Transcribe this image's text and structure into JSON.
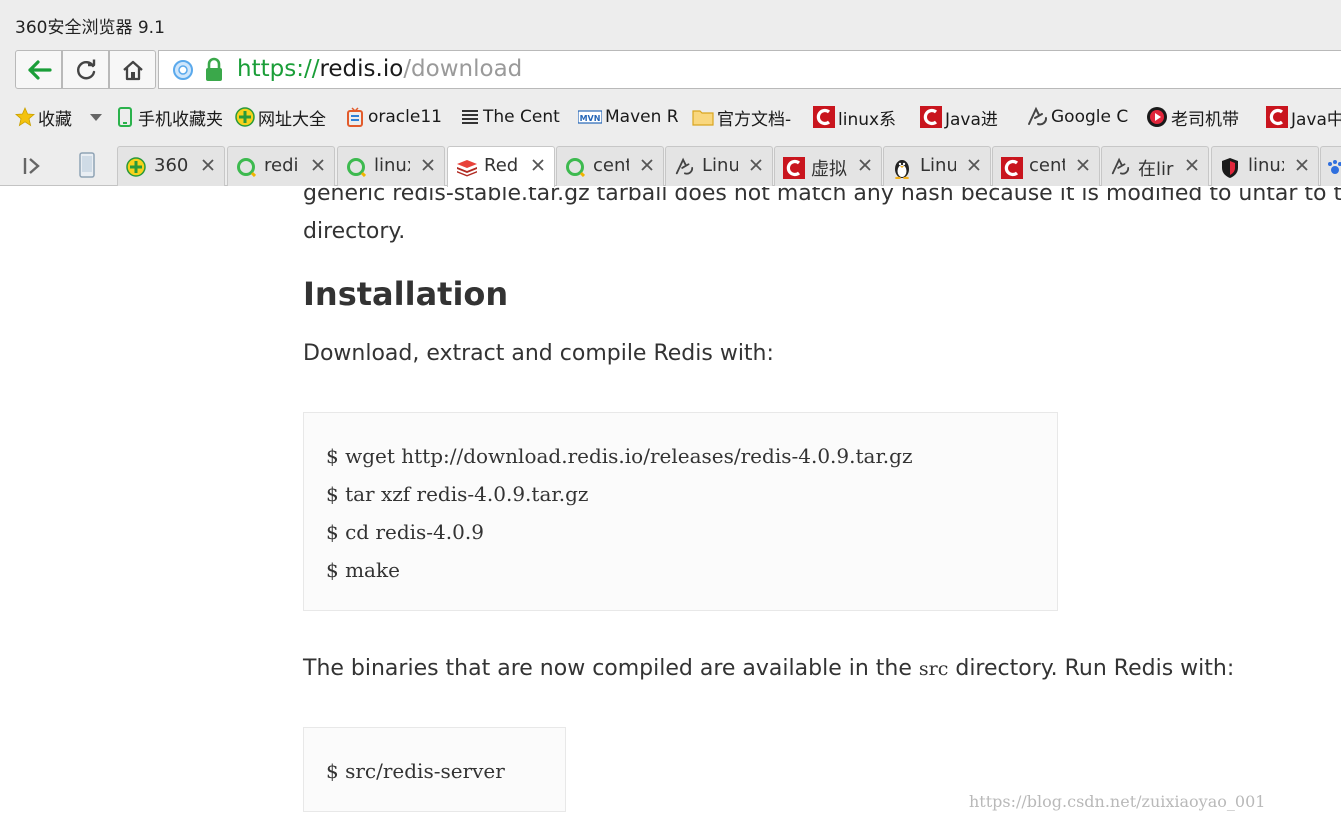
{
  "window": {
    "title": "360安全浏览器 9.1"
  },
  "nav": {
    "url_scheme": "https://",
    "url_host": "redis.io",
    "url_path": "/download"
  },
  "bookmarks": [
    {
      "label": "收藏",
      "icon": "star-icon"
    },
    {
      "label": "手机收藏夹",
      "icon": "phone-icon"
    },
    {
      "label": "网址大全",
      "icon": "360-icon"
    },
    {
      "label": "oracle11",
      "icon": "oracle-icon"
    },
    {
      "label": "The Cent",
      "icon": "doc-icon"
    },
    {
      "label": "Maven R",
      "icon": "mvn-icon"
    },
    {
      "label": "官方文档-",
      "icon": "folder-icon"
    },
    {
      "label": "linux系",
      "icon": "csdn-icon"
    },
    {
      "label": "Java进",
      "icon": "csdn-icon"
    },
    {
      "label": "Google C",
      "icon": "cnblogs-icon"
    },
    {
      "label": "老司机带",
      "icon": "video-icon"
    },
    {
      "label": "Java中",
      "icon": "csdn-icon"
    }
  ],
  "tabs": [
    {
      "label": "360",
      "icon": "360-icon",
      "active": false
    },
    {
      "label": "redi",
      "icon": "loading-icon",
      "active": false
    },
    {
      "label": "linux",
      "icon": "loading-icon",
      "active": false
    },
    {
      "label": "Red",
      "icon": "redis-icon",
      "active": true
    },
    {
      "label": "cent",
      "icon": "loading-icon",
      "active": false
    },
    {
      "label": "Linu",
      "icon": "cnblogs-icon",
      "active": false
    },
    {
      "label": "虚拟",
      "icon": "csdn-icon",
      "active": false
    },
    {
      "label": "Linu",
      "icon": "tux-icon",
      "active": false
    },
    {
      "label": "cent",
      "icon": "csdn-icon",
      "active": false
    },
    {
      "label": "在lir",
      "icon": "cnblogs-icon",
      "active": false
    },
    {
      "label": "linux",
      "icon": "shield-icon",
      "active": false
    }
  ],
  "page": {
    "cut_line": "generic redis-stable.tar.gz tarball does not match any hash because it is modified to untar to t",
    "directory_word": "directory.",
    "heading": "Installation",
    "download_text": "Download, extract and compile Redis with:",
    "code_lines": [
      "$ wget http://download.redis.io/releases/redis-4.0.9.tar.gz",
      "$ tar xzf redis-4.0.9.tar.gz",
      "$ cd redis-4.0.9",
      "$ make"
    ],
    "binaries_text_before": "The binaries that are now compiled are available in the ",
    "binaries_code": "src",
    "binaries_text_after": " directory. Run Redis with:",
    "run_code": "$ src/redis-server"
  },
  "watermark": "https://blog.csdn.net/zuixiaoyao_001",
  "colors": {
    "accent_green": "#1a9e38",
    "csdn_red": "#c9151e",
    "chrome_gray": "#ededed"
  }
}
